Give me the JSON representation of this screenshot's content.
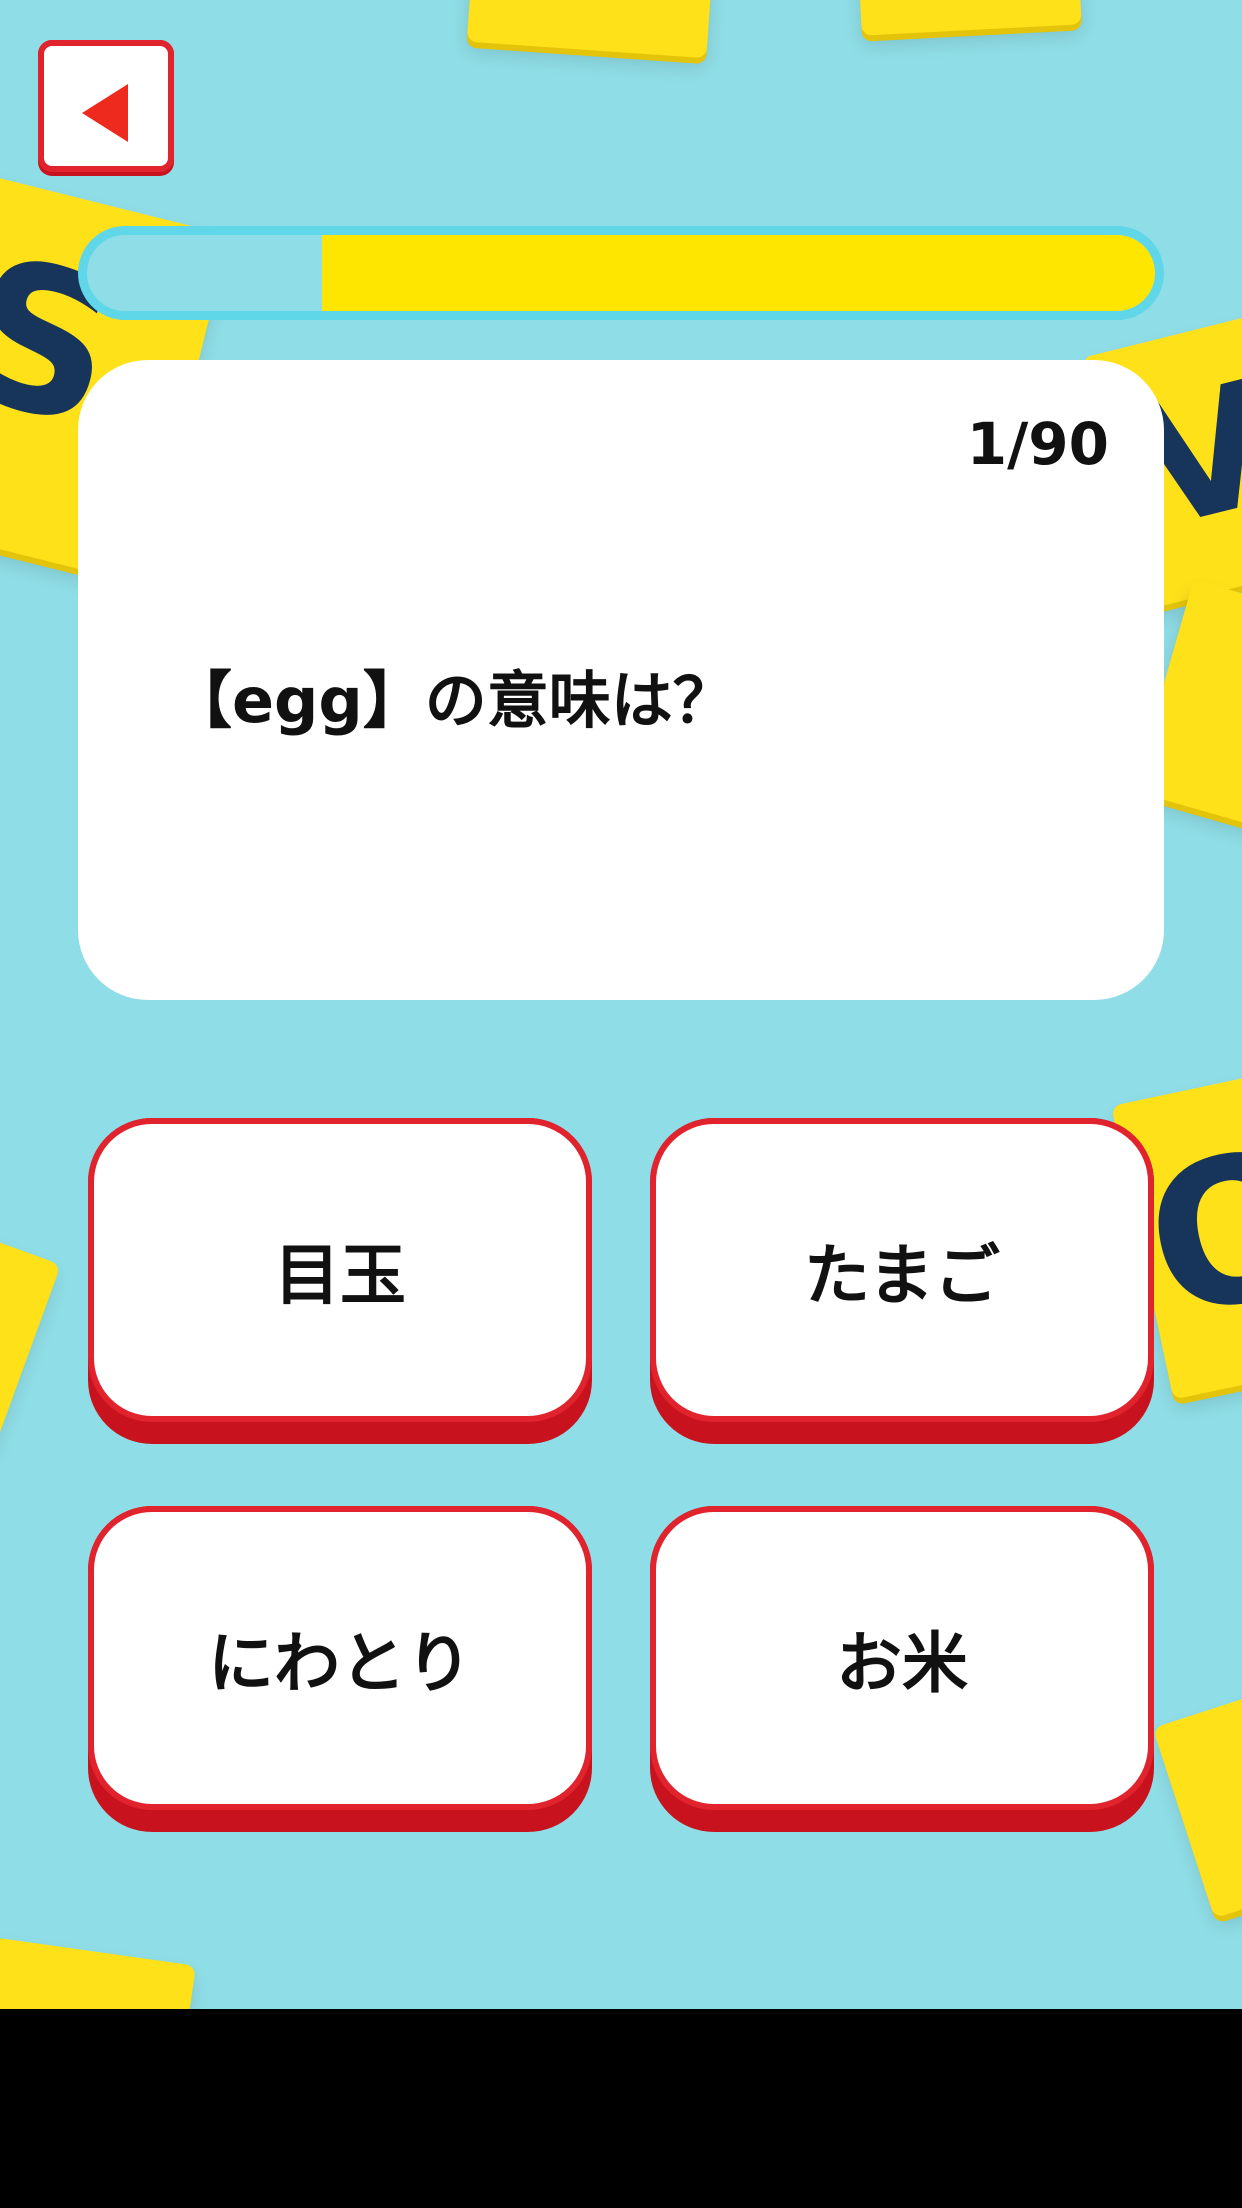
{
  "header": {
    "back_icon": "back-arrow-icon"
  },
  "progress": {
    "remaining_fraction": 0.78,
    "fill_color": "#ffe600",
    "track_color": "#5fd7e8"
  },
  "question": {
    "counter": "1/90",
    "text": "【egg】の意味は？"
  },
  "answers": [
    {
      "label": "目玉"
    },
    {
      "label": "たまご"
    },
    {
      "label": "にわとり"
    },
    {
      "label": "お米"
    }
  ],
  "background": {
    "tiles": [
      "S",
      "V",
      "O"
    ],
    "color": "#8fdde6",
    "tile_color": "#ffe11a"
  },
  "colors": {
    "accent_red": "#e0232d",
    "card": "#ffffff"
  }
}
